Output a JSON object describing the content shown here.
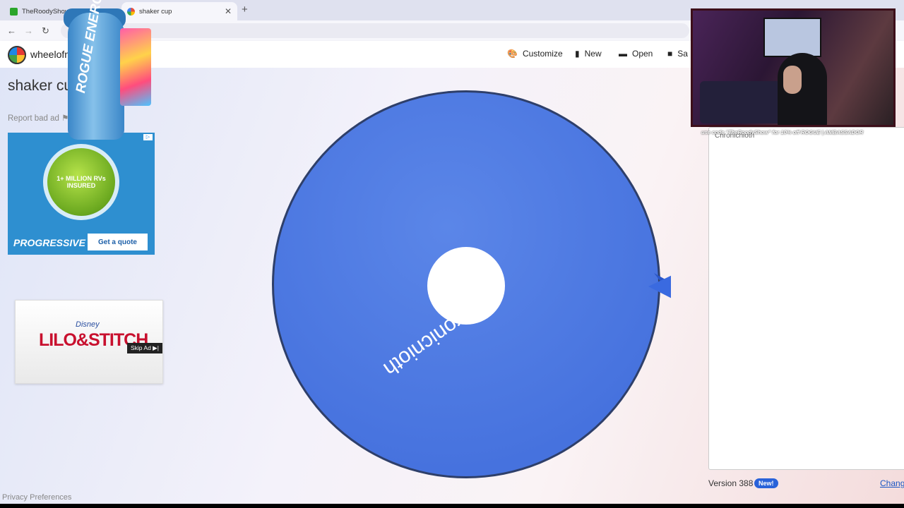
{
  "browser": {
    "tabs": [
      {
        "title": "TheRoodyShow Clips - Watch L",
        "active": false
      },
      {
        "title": "shaker cup",
        "active": true
      }
    ]
  },
  "header": {
    "brand": "wheelofn",
    "menu": [
      {
        "label": "Customize",
        "icon": "palette-icon"
      },
      {
        "label": "New",
        "icon": "file-icon"
      },
      {
        "label": "Open",
        "icon": "folder-icon"
      },
      {
        "label": "Sa",
        "icon": "save-icon"
      }
    ]
  },
  "page": {
    "title": "shaker cu",
    "report_ad": "Report bad ad"
  },
  "ads": {
    "progressive": {
      "headline": "1+ MILLION RVs INSURED",
      "brand": "PROGRESSIVE",
      "cta": "Get a quote"
    },
    "lilo": {
      "brand": "Disney",
      "title": "LILO&STITCH",
      "skip": "Skip Ad ▶|"
    }
  },
  "overlay": {
    "shaker_brand": "ROGUE ENERGY",
    "promo": "use code \"TheRoodyShow\" for 10% off    ROGUE | AMBASSADOR"
  },
  "wheel": {
    "entries": [
      "Chronicnioth"
    ],
    "color": "#4470dd"
  },
  "panel": {
    "entry_text": "Chronicnioth"
  },
  "footer": {
    "version": "Version 388",
    "new_badge": "New!",
    "changelog": "Changel",
    "privacy": "Privacy Preferences"
  }
}
